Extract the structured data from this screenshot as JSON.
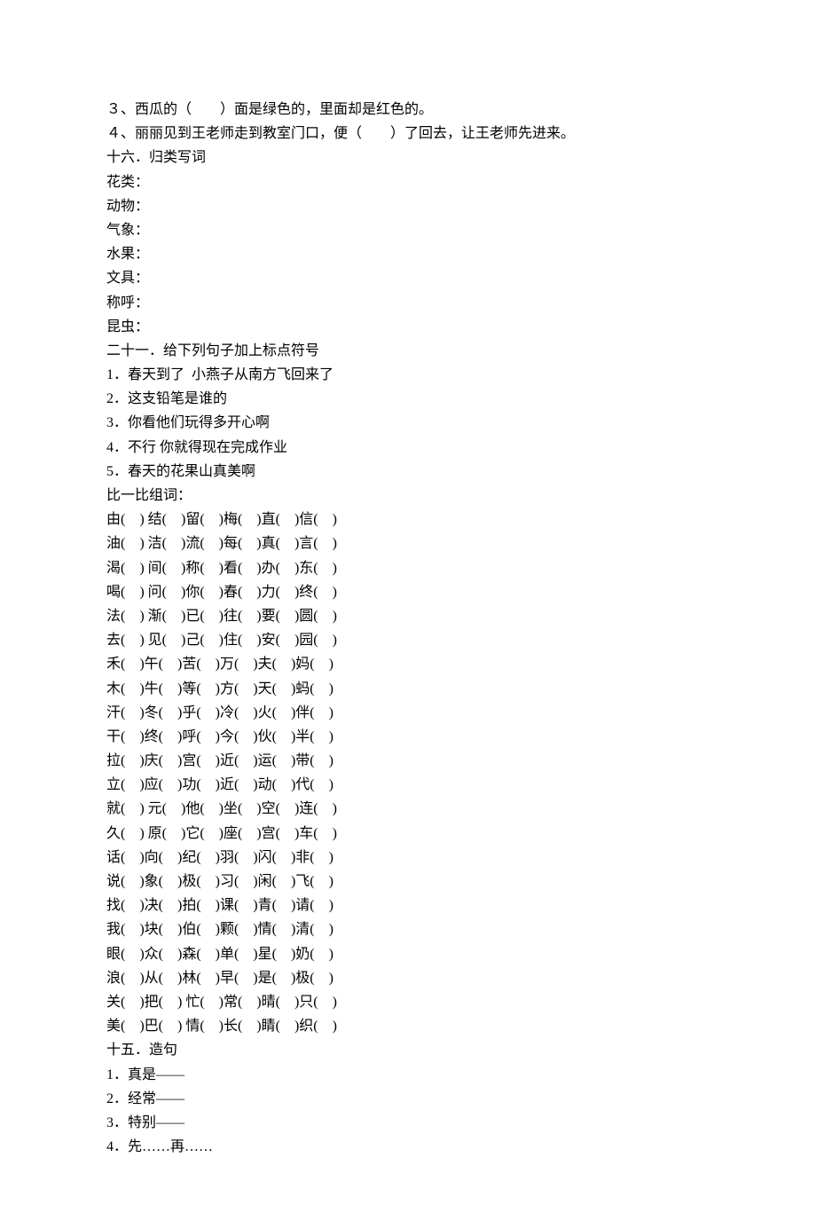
{
  "lines": [
    "３、西瓜的（　　）面是绿色的，里面却是红色的。",
    "４、丽丽见到王老师走到教室门口，便（　　）了回去，让王老师先进来。",
    "十六．归类写词",
    "花类：",
    "动物：",
    "气象：",
    "水果：",
    "文具：",
    "称呼：",
    "昆虫：",
    "二十一．给下列句子加上标点符号",
    "1．春天到了  小燕子从南方飞回来了",
    "2．这支铅笔是谁的",
    "3．你看他们玩得多开心啊",
    "4．不行 你就得现在完成作业",
    "5．春天的花果山真美啊",
    "比一比组词：",
    "由(    ) 结(    )留(    )梅(    )直(    )信(    )",
    "油(    ) 洁(    )流(    )每(    )真(    )言(    )",
    "渴(    ) 间(    )称(    )看(    )办(    )东(    )",
    "喝(    ) 问(    )你(    )春(    )力(    )终(    )",
    "法(    ) 渐(    )已(    )往(    )要(    )圆(    )",
    "去(    ) 见(    )己(    )住(    )安(    )园(    )",
    "禾(    )午(    )苦(    )万(    )夫(    )妈(    )",
    "木(    )牛(    )等(    )方(    )天(    )蚂(    )",
    "汗(    )冬(    )乎(    )冷(    )火(    )伴(    )",
    "干(    )终(    )呼(    )今(    )伙(    )半(    )",
    "拉(    )庆(    )宫(    )近(    )运(    )带(    )",
    "立(    )应(    )功(    )近(    )动(    )代(    )",
    "就(    ) 元(    )他(    )坐(    )空(    )连(    )",
    "久(    ) 原(    )它(    )座(    )宫(    )车(    )",
    "话(    )向(    )纪(    )羽(    )闪(    )非(    )",
    "说(    )象(    )极(    )习(    )闲(    )飞(    )",
    "找(    )决(    )拍(    )课(    )青(    )请(    )",
    "我(    )块(    )伯(    )颗(    )情(    )清(    )",
    "眼(    )众(    )森(    )单(    )星(    )奶(    )",
    "浪(    )从(    )林(    )早(    )是(    )极(    )",
    "关(    )把(    ) 忙(    )常(    )晴(    )只(    )",
    "美(    )巴(    ) 情(    )长(    )睛(    )织(    )",
    "十五．造句",
    "1．真是——",
    "2．经常——",
    "3．特别——",
    "4．先……再……"
  ]
}
